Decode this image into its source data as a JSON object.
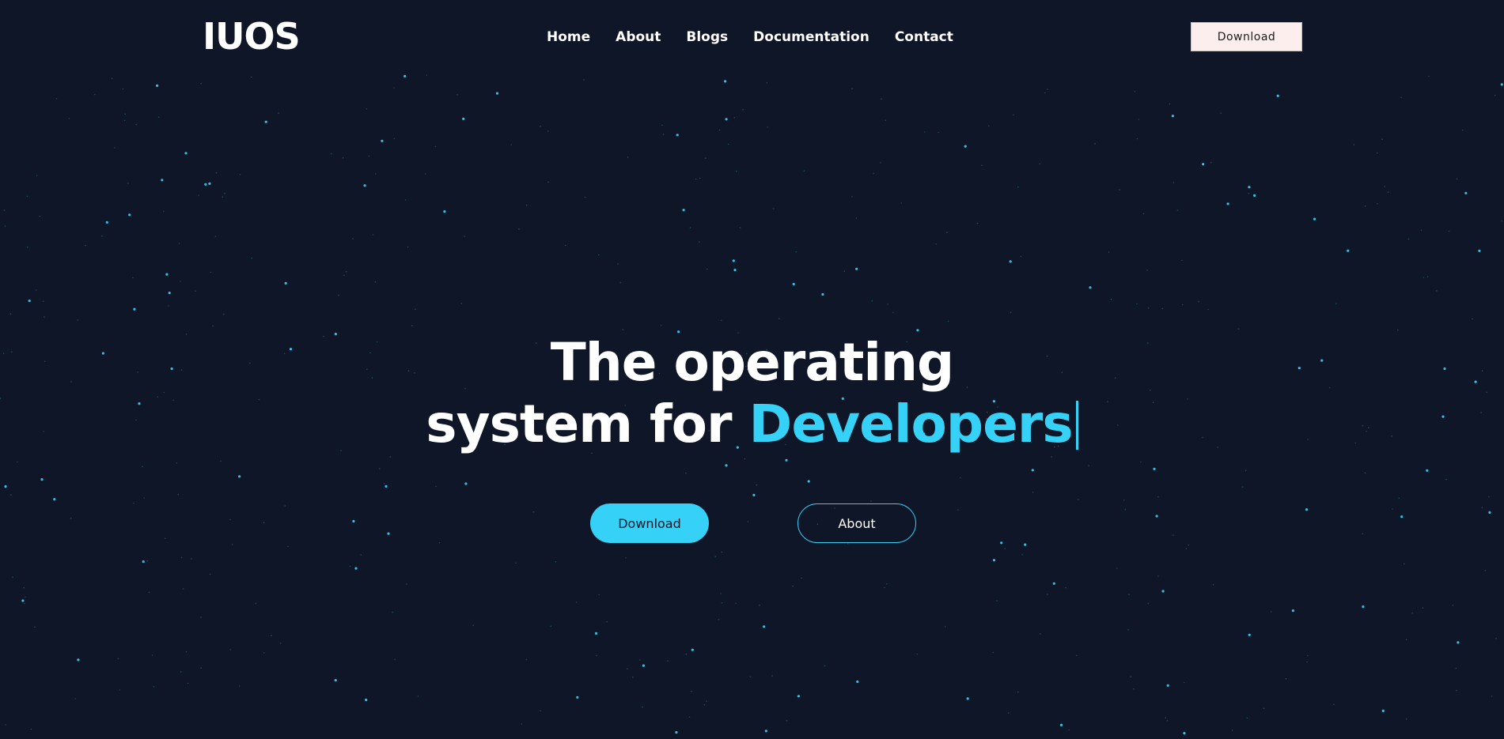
{
  "colors": {
    "background": "#0f1627",
    "accent": "#36d1f7",
    "text": "#ffffff",
    "nav_button_bg": "#fdeeee"
  },
  "header": {
    "logo": "IUOS",
    "nav": [
      {
        "label": "Home"
      },
      {
        "label": "About"
      },
      {
        "label": "Blogs"
      },
      {
        "label": "Documentation"
      },
      {
        "label": "Contact"
      }
    ],
    "download_label": "Download"
  },
  "hero": {
    "line1": "The operating",
    "line2_prefix": "system for",
    "line2_accent": "Developers",
    "primary_button": "Download",
    "secondary_button": "About"
  }
}
